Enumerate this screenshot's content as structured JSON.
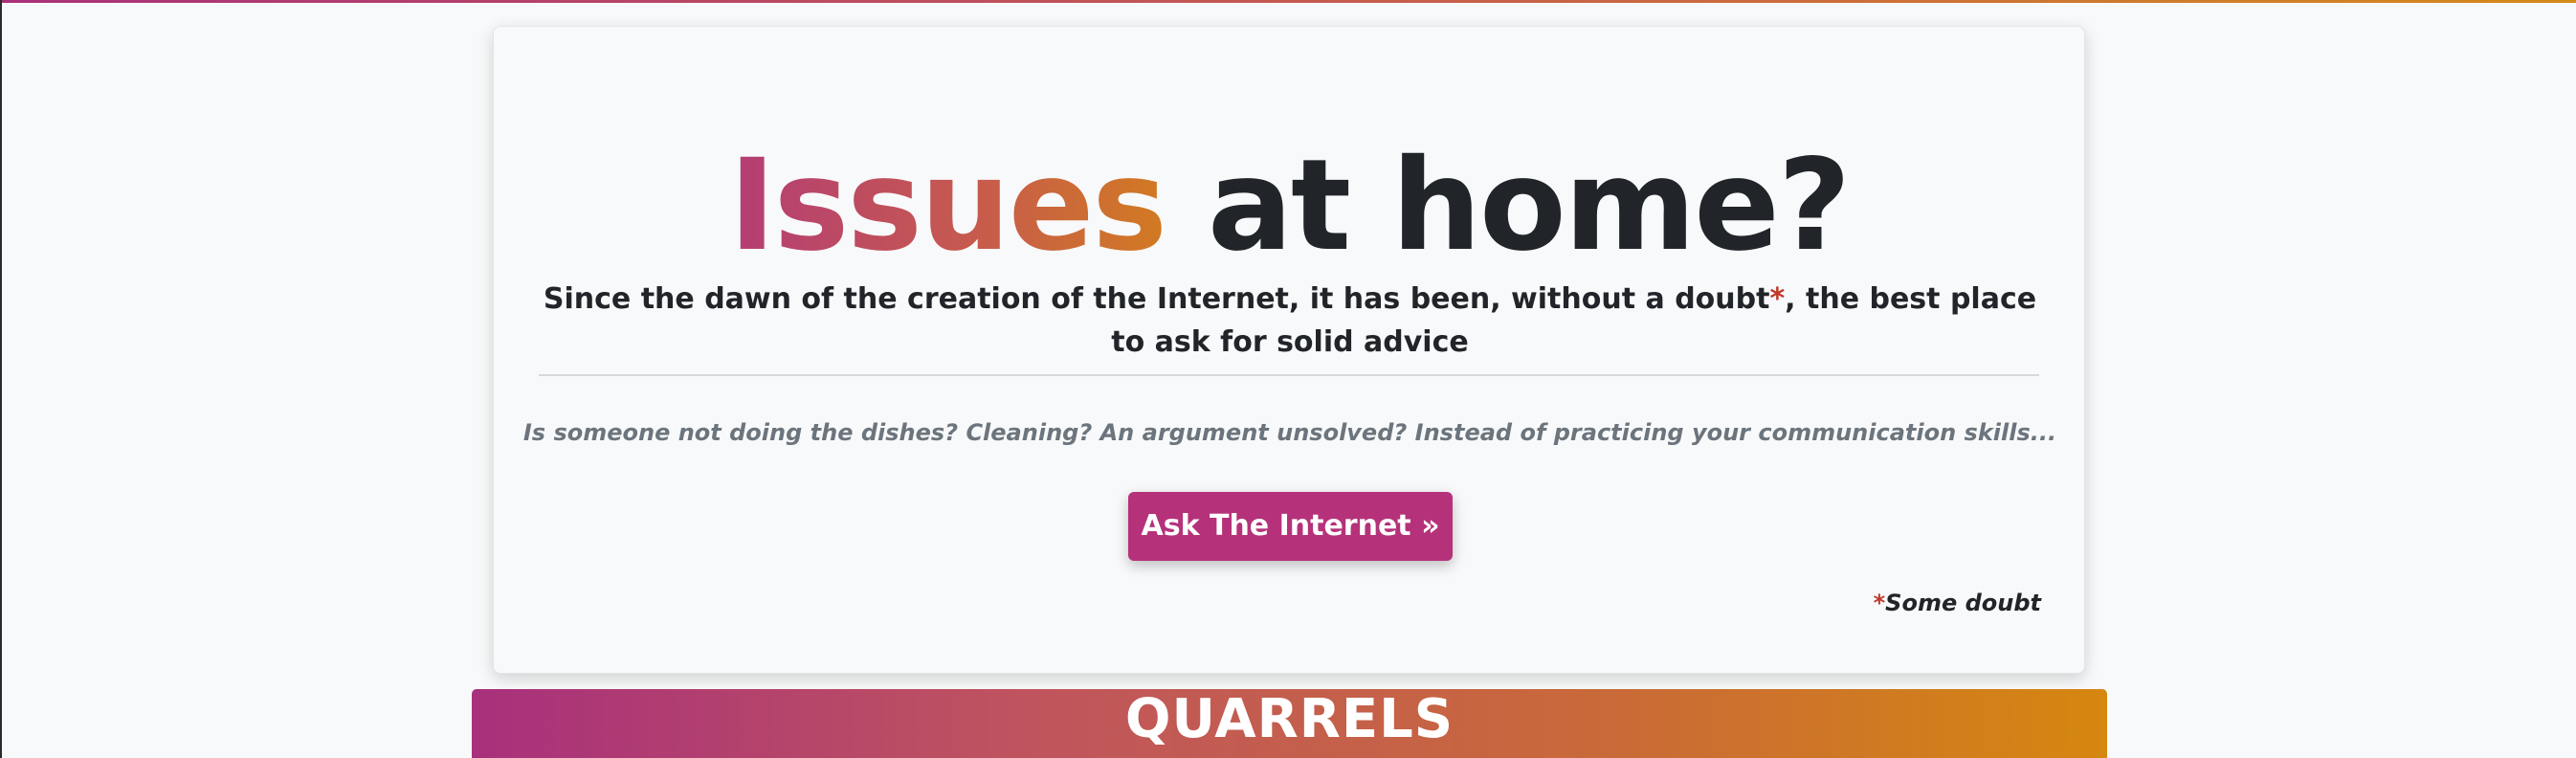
{
  "hero": {
    "title_highlight": "Issues",
    "title_rest": " at home?",
    "subtitle_before": "Since the dawn of the creation of the Internet, it has been, without a doubt",
    "subtitle_asterisk": "*",
    "subtitle_after": ", the best place to ask for solid advice",
    "lead": "Is someone not doing the dishes? Cleaning? An argument unsolved? Instead of practicing your communication skills...",
    "button_label": "Ask The Internet »",
    "footnote_asterisk": "*",
    "footnote_text": "Some doubt"
  },
  "section": {
    "title": "QUARRELS"
  },
  "colors": {
    "accent": "#b5327a",
    "gradient_start": "#a8307c",
    "gradient_end": "#d5870f",
    "asterisk": "#c0392b"
  }
}
